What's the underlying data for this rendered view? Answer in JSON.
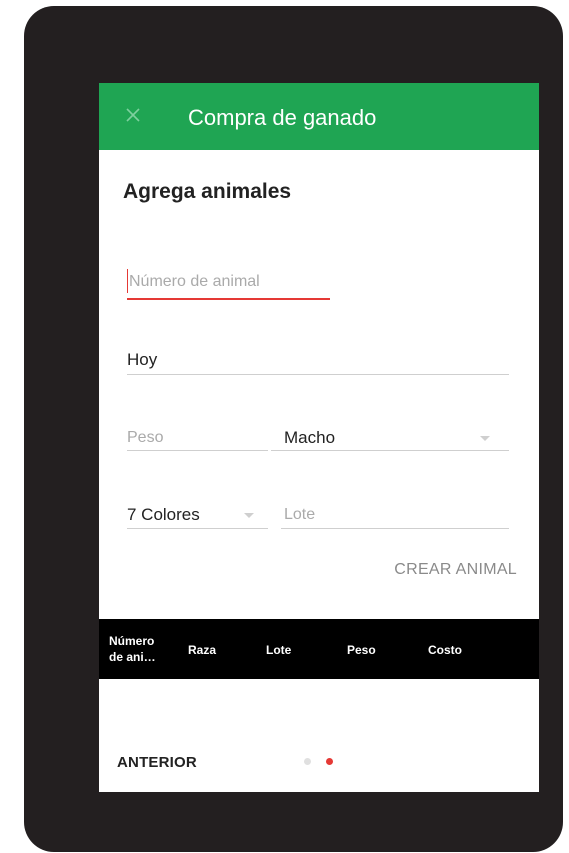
{
  "colors": {
    "appbar": "#1fa553",
    "accent_error": "#e53935",
    "header_bg": "#000000",
    "device": "#231f20"
  },
  "appbar": {
    "close_icon": "close-icon",
    "title": "Compra de ganado"
  },
  "form": {
    "heading": "Agrega animales",
    "animal_number": {
      "placeholder": "Número de animal",
      "value": ""
    },
    "date": {
      "value": "Hoy"
    },
    "weight": {
      "placeholder": "Peso",
      "value": ""
    },
    "sex": {
      "value": "Macho"
    },
    "breed": {
      "value": "7 Colores"
    },
    "lot": {
      "placeholder": "Lote",
      "value": ""
    },
    "create_label": "CREAR ANIMAL"
  },
  "table": {
    "columns": [
      "Número de ani…",
      "Raza",
      "Lote",
      "Peso",
      "Costo"
    ]
  },
  "footer": {
    "back_label": "ANTERIOR",
    "pager": {
      "pages": 2,
      "active_index": 1
    }
  }
}
